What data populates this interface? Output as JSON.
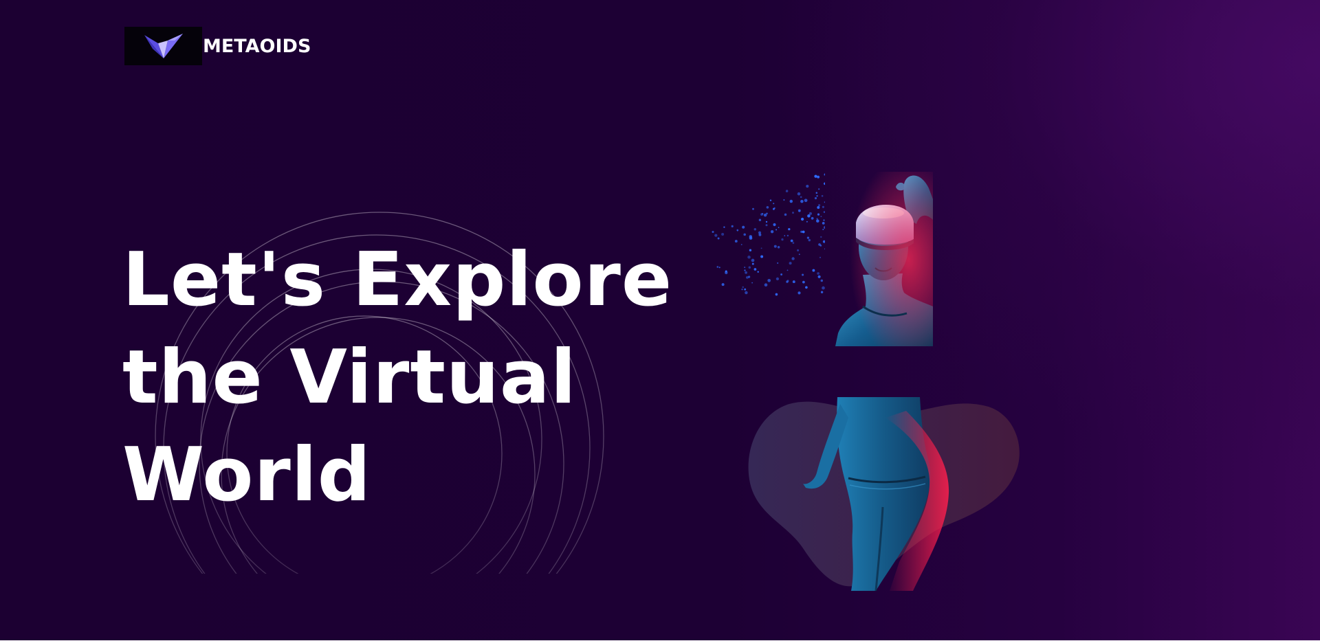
{
  "brand": {
    "name": "METAOIDS",
    "logo_icon": "metaoids-logo-icon"
  },
  "hero": {
    "title_lines": [
      "Let's Explore",
      "the Virtual",
      "World"
    ]
  },
  "illustration": {
    "subject": "vr-headset-figure",
    "particles_icon": "particle-cloud",
    "backdrop_icon": "blob-shape"
  },
  "colors": {
    "background": "#1c0032",
    "background_accent": "#3a0554",
    "text": "#ffffff",
    "logo_box": "#05020a",
    "logo_primary": "#6b5cf0",
    "logo_light": "#c9c2ff",
    "particles": "#2f6bff",
    "figure_blue": "#1d6fa8",
    "figure_red": "#e0204a"
  }
}
